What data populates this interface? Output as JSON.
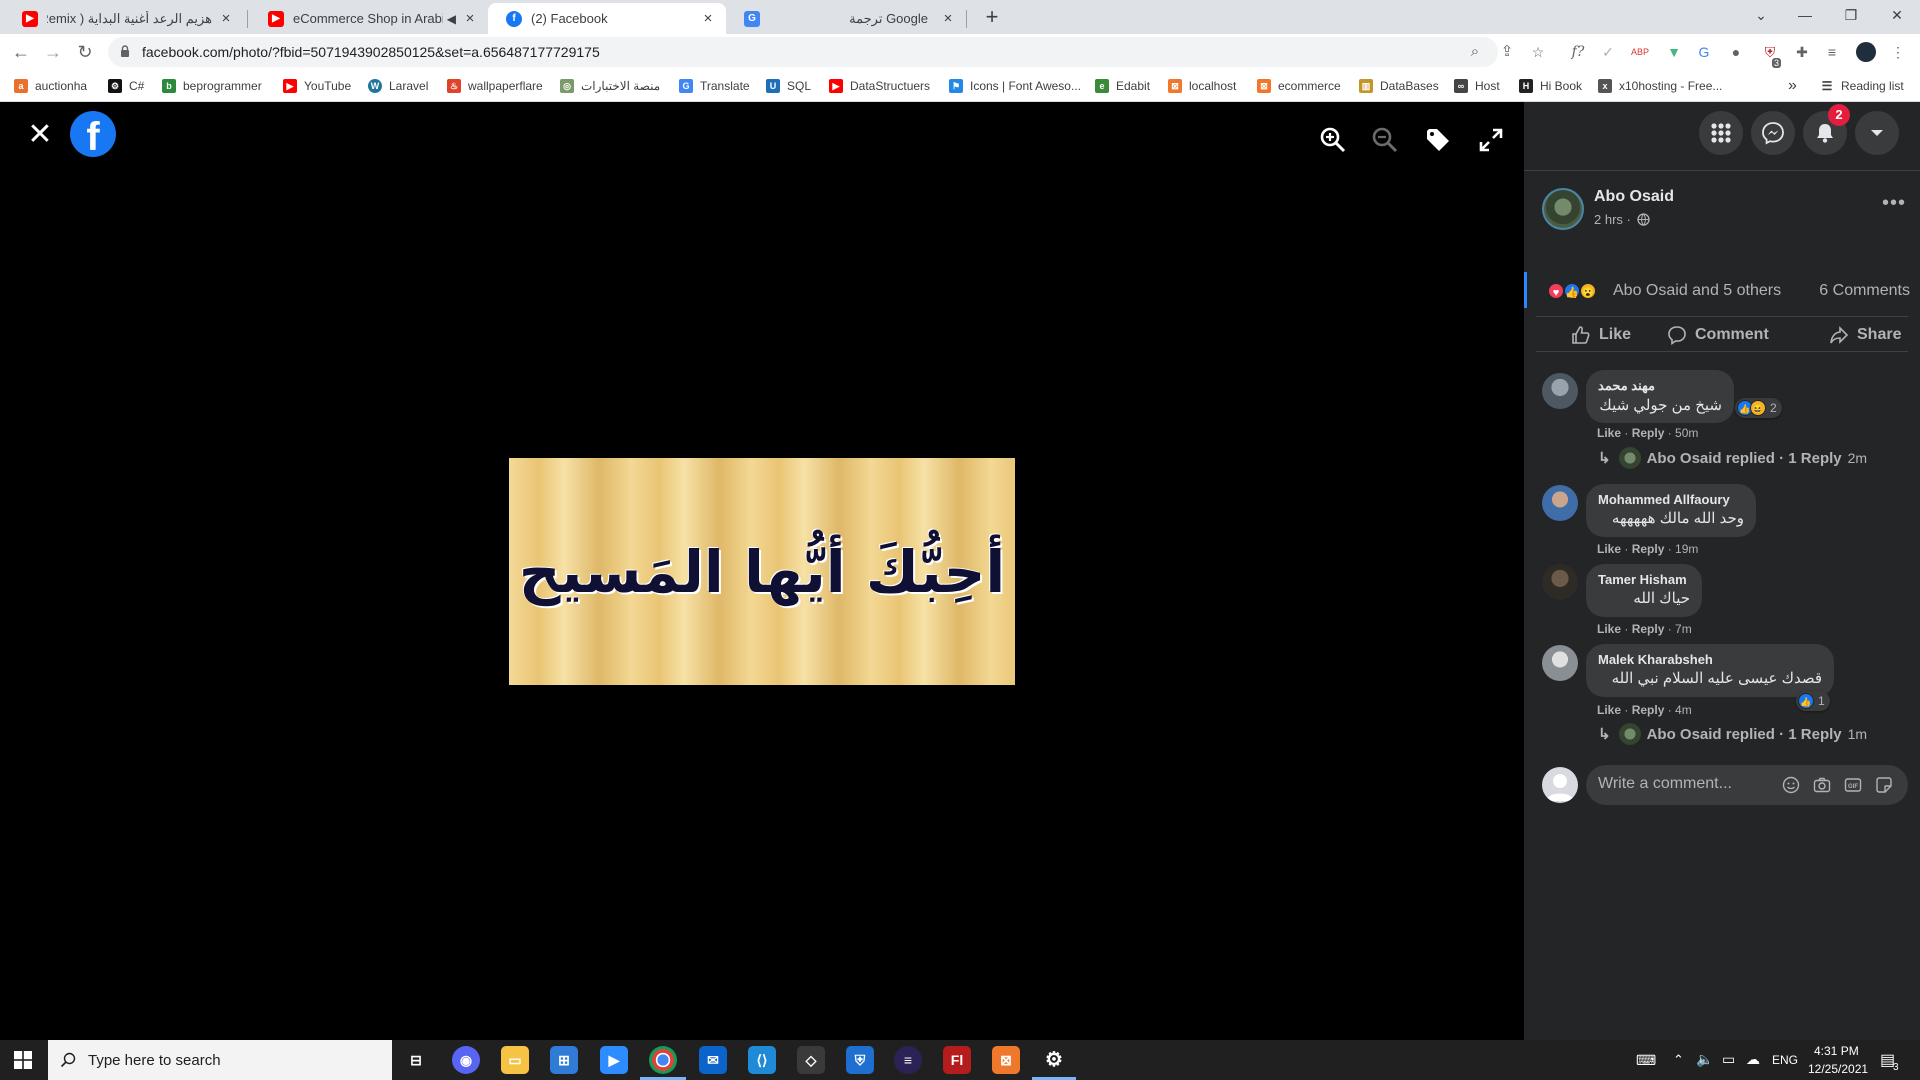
{
  "browser": {
    "tabs": [
      {
        "title": "هزيم الرعد أغنية البداية ( Remix ) |",
        "icon": "youtube-icon",
        "color": "#ff0000"
      },
      {
        "title": "eCommerce Shop in Arabic #",
        "icon": "youtube-icon",
        "color": "#ff0000",
        "muted_icon": "speaker-mute-icon"
      },
      {
        "title": "(2) Facebook",
        "icon": "facebook-icon",
        "color": "#1877f2"
      },
      {
        "title": "ترجمة Google",
        "icon": "google-translate-icon",
        "color": "#4285f4"
      }
    ],
    "new_tab": "+",
    "url": "facebook.com/photo/?fbid=5071943902850125&set=a.656487177729175",
    "bookmarks": [
      {
        "label": "auctionha",
        "color": "#e8712d"
      },
      {
        "label": "C#",
        "color": "#111111"
      },
      {
        "label": "beprogrammer",
        "color": "#2d8a3d"
      },
      {
        "label": "YouTube",
        "color": "#ff0000"
      },
      {
        "label": "Laravel",
        "color": "#21759b"
      },
      {
        "label": "wallpaperflare",
        "color": "#e0422a"
      },
      {
        "label": "منصة الاختبارات",
        "color": "#7a9a6a"
      },
      {
        "label": "Translate",
        "color": "#4285f4"
      },
      {
        "label": "SQL",
        "color": "#1e6fb8"
      },
      {
        "label": "DataStructuers",
        "color": "#ff0000"
      },
      {
        "label": "Icons | Font Aweso...",
        "color": "#228ae6"
      },
      {
        "label": "Edabit",
        "color": "#3a8a3a"
      },
      {
        "label": "localhost",
        "color": "#f0782d"
      },
      {
        "label": "ecommerce",
        "color": "#f0782d"
      },
      {
        "label": "DataBases",
        "color": "#c4962a"
      },
      {
        "label": "Host",
        "color": "#444444"
      },
      {
        "label": "Hi Book",
        "color": "#222222"
      },
      {
        "label": "x10hosting - Free...",
        "color": "#555555"
      }
    ],
    "more_bookmarks": "»",
    "reading_list": "Reading list",
    "extension_badge": "3"
  },
  "viewer": {
    "photo_text": "أحِبُّكَ أيُّها المَسيح"
  },
  "panel": {
    "notification_count": "2",
    "author": "Abo Osaid",
    "post_time": "2 hrs ·",
    "reactors": "Abo Osaid and 5 others",
    "comments_count": "6 Comments",
    "actions": {
      "like": "Like",
      "comment": "Comment",
      "share": "Share"
    },
    "comments": [
      {
        "name": "مهند محمد",
        "text": "شيخ من جولي شيك",
        "like": "Like",
        "reply": "Reply",
        "age": "50m",
        "reaction_count": "2",
        "reply_thread": {
          "text": "Abo Osaid replied · 1 Reply",
          "age": "2m"
        }
      },
      {
        "name": "Mohammed Allfaoury",
        "text": "وحد الله مالك هههههه",
        "like": "Like",
        "reply": "Reply",
        "age": "19m"
      },
      {
        "name": "Tamer Hisham",
        "text": "حياك الله",
        "like": "Like",
        "reply": "Reply",
        "age": "7m"
      },
      {
        "name": "Malek Kharabsheh",
        "text": "قصدك عيسى عليه السلام نبي الله",
        "like": "Like",
        "reply": "Reply",
        "age": "4m",
        "reaction_count": "1",
        "reply_thread": {
          "text": "Abo Osaid replied · 1 Reply",
          "age": "1m"
        }
      }
    ],
    "write_placeholder": "Write a comment..."
  },
  "taskbar": {
    "search_placeholder": "Type here to search",
    "language": "ENG",
    "time": "4:31 PM",
    "date": "12/25/2021",
    "notification_badge": "3"
  },
  "colors": {
    "facebook_blue": "#1877f2",
    "panel_bg": "#242526",
    "bubble_bg": "#3a3b3c",
    "notification_red": "#e41e3f"
  }
}
